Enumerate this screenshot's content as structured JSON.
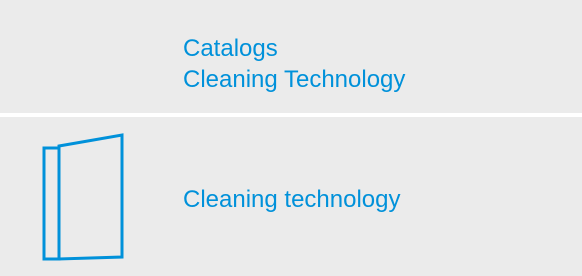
{
  "header": {
    "line1": "Catalogs",
    "line2": "Cleaning Technology"
  },
  "items": [
    {
      "label": "Cleaning technology",
      "icon": "catalog-book-icon"
    }
  ],
  "colors": {
    "accent": "#0091da",
    "background": "#ebebeb",
    "separator": "#ffffff"
  }
}
